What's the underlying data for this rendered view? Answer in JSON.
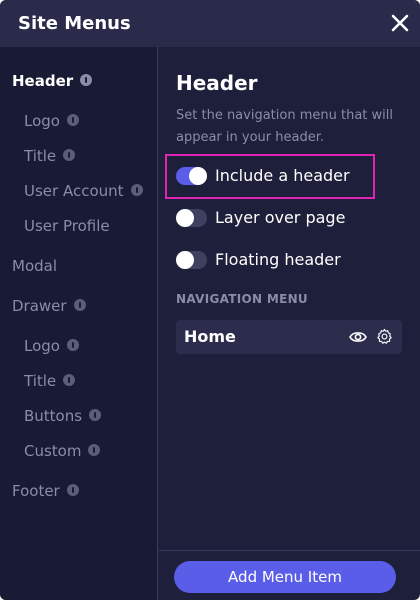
{
  "window": {
    "title": "Site Menus"
  },
  "sidebar": {
    "items": [
      {
        "label": "Header",
        "info": true
      },
      {
        "label": "Logo",
        "info": true
      },
      {
        "label": "Title",
        "info": true
      },
      {
        "label": "User Account",
        "info": true
      },
      {
        "label": "User Profile",
        "info": false
      },
      {
        "label": "Modal",
        "info": false
      },
      {
        "label": "Drawer",
        "info": true
      },
      {
        "label": "Logo",
        "info": true
      },
      {
        "label": "Title",
        "info": true
      },
      {
        "label": "Buttons",
        "info": true
      },
      {
        "label": "Custom",
        "info": true
      },
      {
        "label": "Footer",
        "info": true
      }
    ]
  },
  "main": {
    "title": "Header",
    "description": "Set the navigation menu that will appear in your header.",
    "toggles": [
      {
        "label": "Include a header",
        "on": true
      },
      {
        "label": "Layer over page",
        "on": false
      },
      {
        "label": "Floating header",
        "on": false
      }
    ],
    "nav_heading": "NAVIGATION MENU",
    "nav_items": [
      {
        "label": "Home"
      }
    ]
  },
  "footer": {
    "add_label": "Add Menu Item"
  },
  "colors": {
    "background": "#1e1f3a",
    "sidebar": "#191a33",
    "accent": "#5a5de8",
    "highlight": "#e024b3",
    "muted_text": "#8b8da8"
  },
  "icons": [
    "info-icon",
    "close-icon",
    "eye-icon",
    "gear-icon"
  ]
}
